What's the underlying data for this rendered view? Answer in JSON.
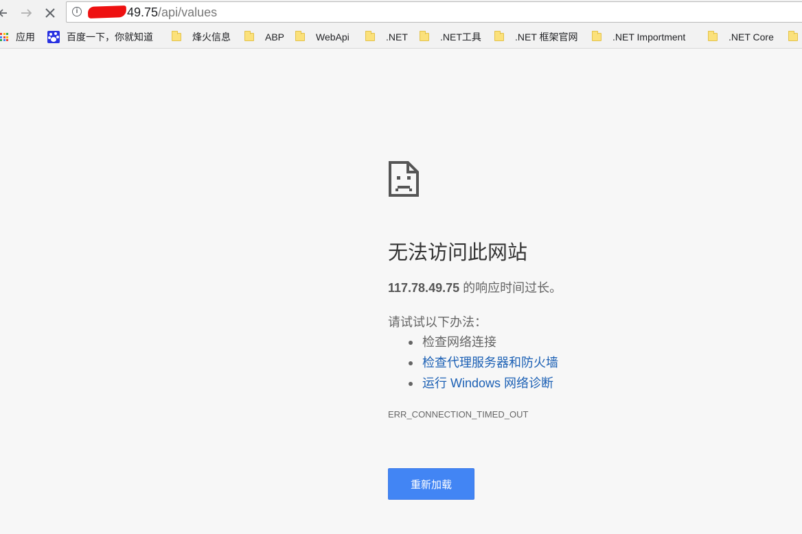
{
  "browser": {
    "url_visible": "49.75",
    "url_path": "/api/values"
  },
  "bookmarks": [
    {
      "label": "应用",
      "icon": "apps-grid-icon"
    },
    {
      "label": "百度一下，你就知道",
      "icon": "baidu-paw-icon"
    },
    {
      "label": "烽火信息",
      "icon": "folder-icon"
    },
    {
      "label": "ABP",
      "icon": "folder-icon"
    },
    {
      "label": "WebApi",
      "icon": "folder-icon"
    },
    {
      "label": ".NET",
      "icon": "folder-icon"
    },
    {
      "label": ".NET工具",
      "icon": "folder-icon"
    },
    {
      "label": ".NET 框架官网",
      "icon": "folder-icon"
    },
    {
      "label": ".NET Importment",
      "icon": "folder-icon"
    },
    {
      "label": ".NET Core",
      "icon": "folder-icon"
    }
  ],
  "error": {
    "title": "无法访问此网站",
    "host": "117.78.49.75",
    "message_suffix": " 的响应时间过长。",
    "suggest_heading": "请试试以下办法：",
    "suggestions": [
      {
        "label": "检查网络连接",
        "link": false
      },
      {
        "label": "检查代理服务器和防火墙",
        "link": true
      },
      {
        "label": "运行 Windows 网络诊断",
        "link": true
      }
    ],
    "code": "ERR_CONNECTION_TIMED_OUT",
    "reload_label": "重新加载"
  },
  "colors": {
    "background": "#f7f7f7",
    "link": "#1a5fb4",
    "button": "#4285f4"
  }
}
